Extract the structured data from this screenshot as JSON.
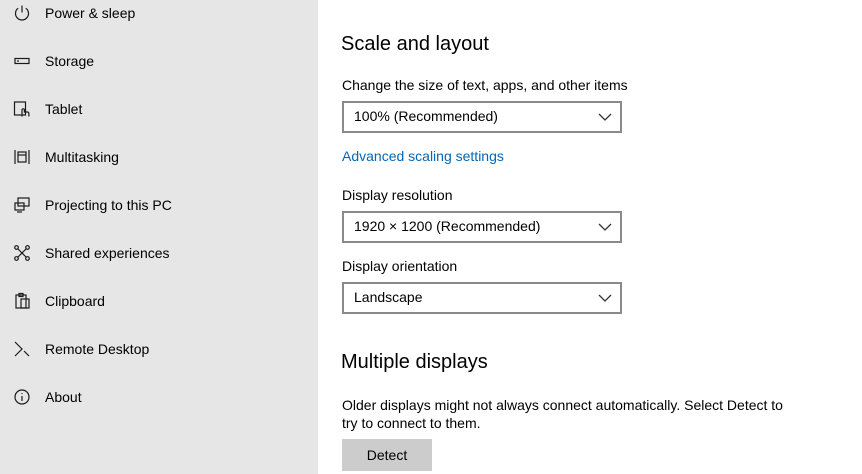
{
  "sidebar": {
    "items": [
      {
        "label": "Power & sleep",
        "icon": "power-icon"
      },
      {
        "label": "Storage",
        "icon": "storage-icon"
      },
      {
        "label": "Tablet",
        "icon": "tablet-icon"
      },
      {
        "label": "Multitasking",
        "icon": "multitasking-icon"
      },
      {
        "label": "Projecting to this PC",
        "icon": "projecting-icon"
      },
      {
        "label": "Shared experiences",
        "icon": "shared-experiences-icon"
      },
      {
        "label": "Clipboard",
        "icon": "clipboard-icon"
      },
      {
        "label": "Remote Desktop",
        "icon": "remote-desktop-icon"
      },
      {
        "label": "About",
        "icon": "info-icon"
      }
    ]
  },
  "scale_layout": {
    "heading": "Scale and layout",
    "size_label": "Change the size of text, apps, and other items",
    "size_value": "100% (Recommended)",
    "advanced_link": "Advanced scaling settings",
    "resolution_label": "Display resolution",
    "resolution_value": "1920 × 1200 (Recommended)",
    "orientation_label": "Display orientation",
    "orientation_value": "Landscape"
  },
  "multiple_displays": {
    "heading": "Multiple displays",
    "description": "Older displays might not always connect automatically. Select Detect to try to connect to them.",
    "detect_label": "Detect"
  },
  "colors": {
    "sidebar_bg": "#e6e6e6",
    "link": "#0067b8",
    "button_bg": "#cccccc"
  }
}
